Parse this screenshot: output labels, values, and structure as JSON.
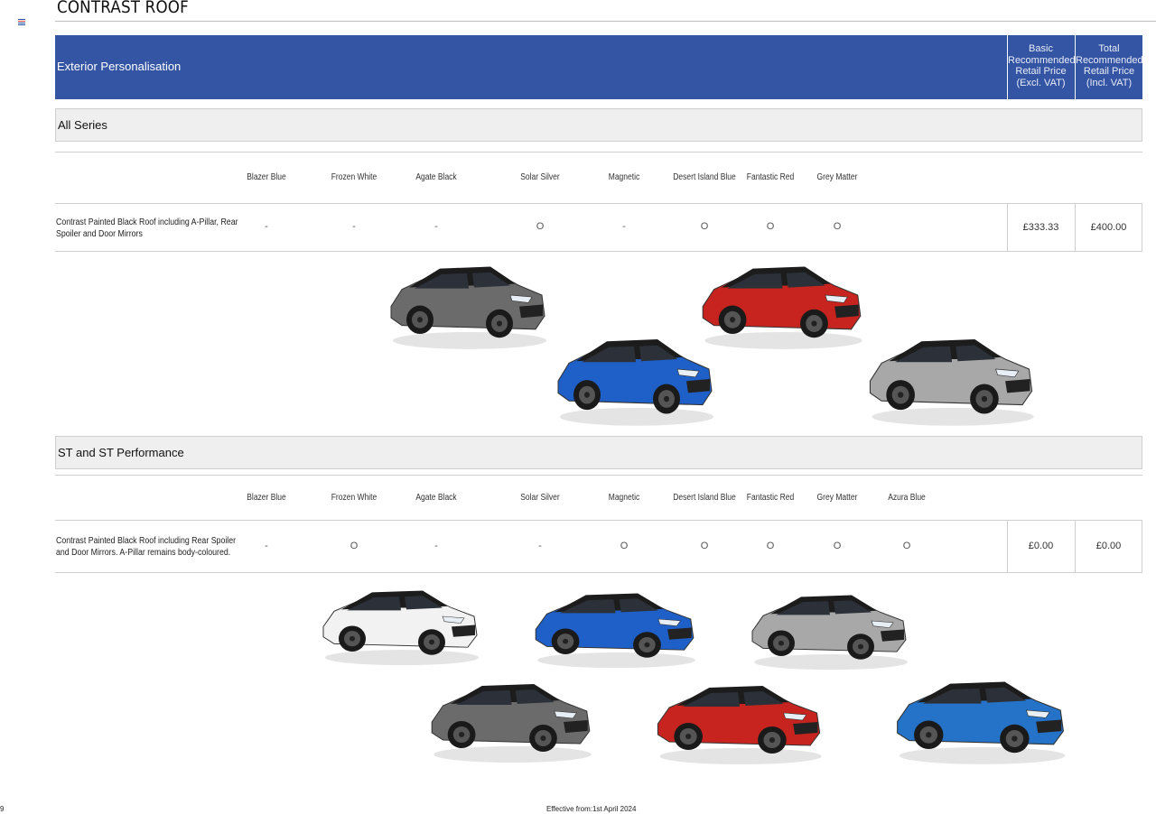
{
  "page": {
    "title": "CONTRAST ROOF",
    "page_number": "9",
    "effective": "Effective from:1st April 2024"
  },
  "header": {
    "label": "Exterior Personalisation",
    "col_basic": "Basic Recommended Retail Price (Excl. VAT)",
    "col_total": "Total Recommended Retail Price (Incl. VAT)"
  },
  "all_series": {
    "section_label": "All Series",
    "colours": [
      "Blazer Blue",
      "Frozen White",
      "Agate Black",
      "Solar Silver",
      "Magnetic",
      "Desert Island Blue",
      "Fantastic Red",
      "Grey Matter"
    ],
    "row": {
      "description": "Contrast Painted Black Roof including A-Pillar, Rear Spoiler and Door Mirrors",
      "values": [
        "-",
        "-",
        "-",
        "O",
        "-",
        "O",
        "O",
        "O"
      ],
      "basic_price": "£333.33",
      "total_price": "£400.00"
    },
    "cars": [
      "Magnetic",
      "Desert Island Blue",
      "Fantastic Red",
      "Solar Silver"
    ]
  },
  "st_series": {
    "section_label": "ST and ST Performance",
    "colours": [
      "Blazer Blue",
      "Frozen White",
      "Agate Black",
      "Solar Silver",
      "Magnetic",
      "Desert Island Blue",
      "Fantastic Red",
      "Grey Matter",
      "Azura Blue"
    ],
    "row": {
      "description": "Contrast Painted Black Roof including Rear Spoiler and Door Mirrors. A-Pillar remains body-coloured.",
      "values": [
        "-",
        "O",
        "-",
        "-",
        "O",
        "O",
        "O",
        "O",
        "O"
      ],
      "basic_price": "£0.00",
      "total_price": "£0.00"
    },
    "cars": [
      "Frozen White",
      "Desert Island Blue",
      "Solar Silver",
      "Magnetic",
      "Fantastic Red",
      "Azura Blue"
    ]
  },
  "colors": {
    "header_blue": "#3454a4",
    "magnetic": "#6b6b6b",
    "desert_island_blue": "#1f5fc8",
    "fantastic_red": "#c8241f",
    "solar_silver": "#a8a8a8",
    "frozen_white": "#f2f2f2",
    "azura_blue": "#2473c9",
    "logo": [
      "#2a4aa0",
      "#e05050",
      "#2a4aa0"
    ]
  }
}
